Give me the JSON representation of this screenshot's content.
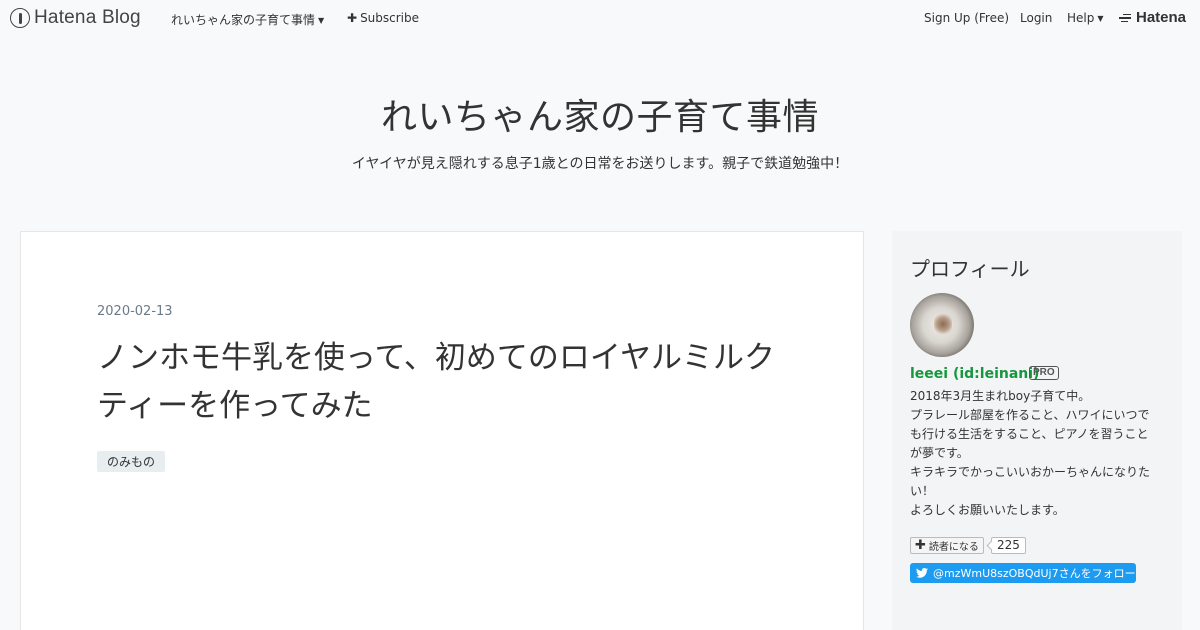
{
  "topbar": {
    "logo_text": "Hatena Blog",
    "blog_menu": "れいちゃん家の子育て事情",
    "subscribe": "Subscribe",
    "signup": "Sign Up (Free)",
    "login": "Login",
    "help": "Help",
    "hatena": "Hatena"
  },
  "header": {
    "title": "れいちゃん家の子育て事情",
    "description": "イヤイヤが見え隠れする息子1歳との日常をお送りします。親子で鉄道勉強中！"
  },
  "article": {
    "date": "2020-02-13",
    "title": "ノンホモ牛乳を使って、初めてのロイヤルミルクティーを作ってみた",
    "category": "のみもの"
  },
  "sidebar": {
    "heading": "プロフィール",
    "name": "leeei (id:leinani)",
    "badge": "PRO",
    "bio": [
      "2018年3月生まれboy子育て中。",
      "プラレール部屋を作ること、ハワイにいつでも行ける生活をすること、ピアノを習うことが夢です。",
      "キラキラでかっこいいおかーちゃんになりたい！",
      "よろしくお願いいたします。"
    ],
    "reader_button": "読者になる",
    "reader_count": "225",
    "twitter_follow": "@mzWmU8szOBQdUj7さんをフォロー"
  },
  "colors": {
    "background": "#f8f9fa",
    "profile_link": "#17963f",
    "twitter": "#1d9bf0"
  }
}
